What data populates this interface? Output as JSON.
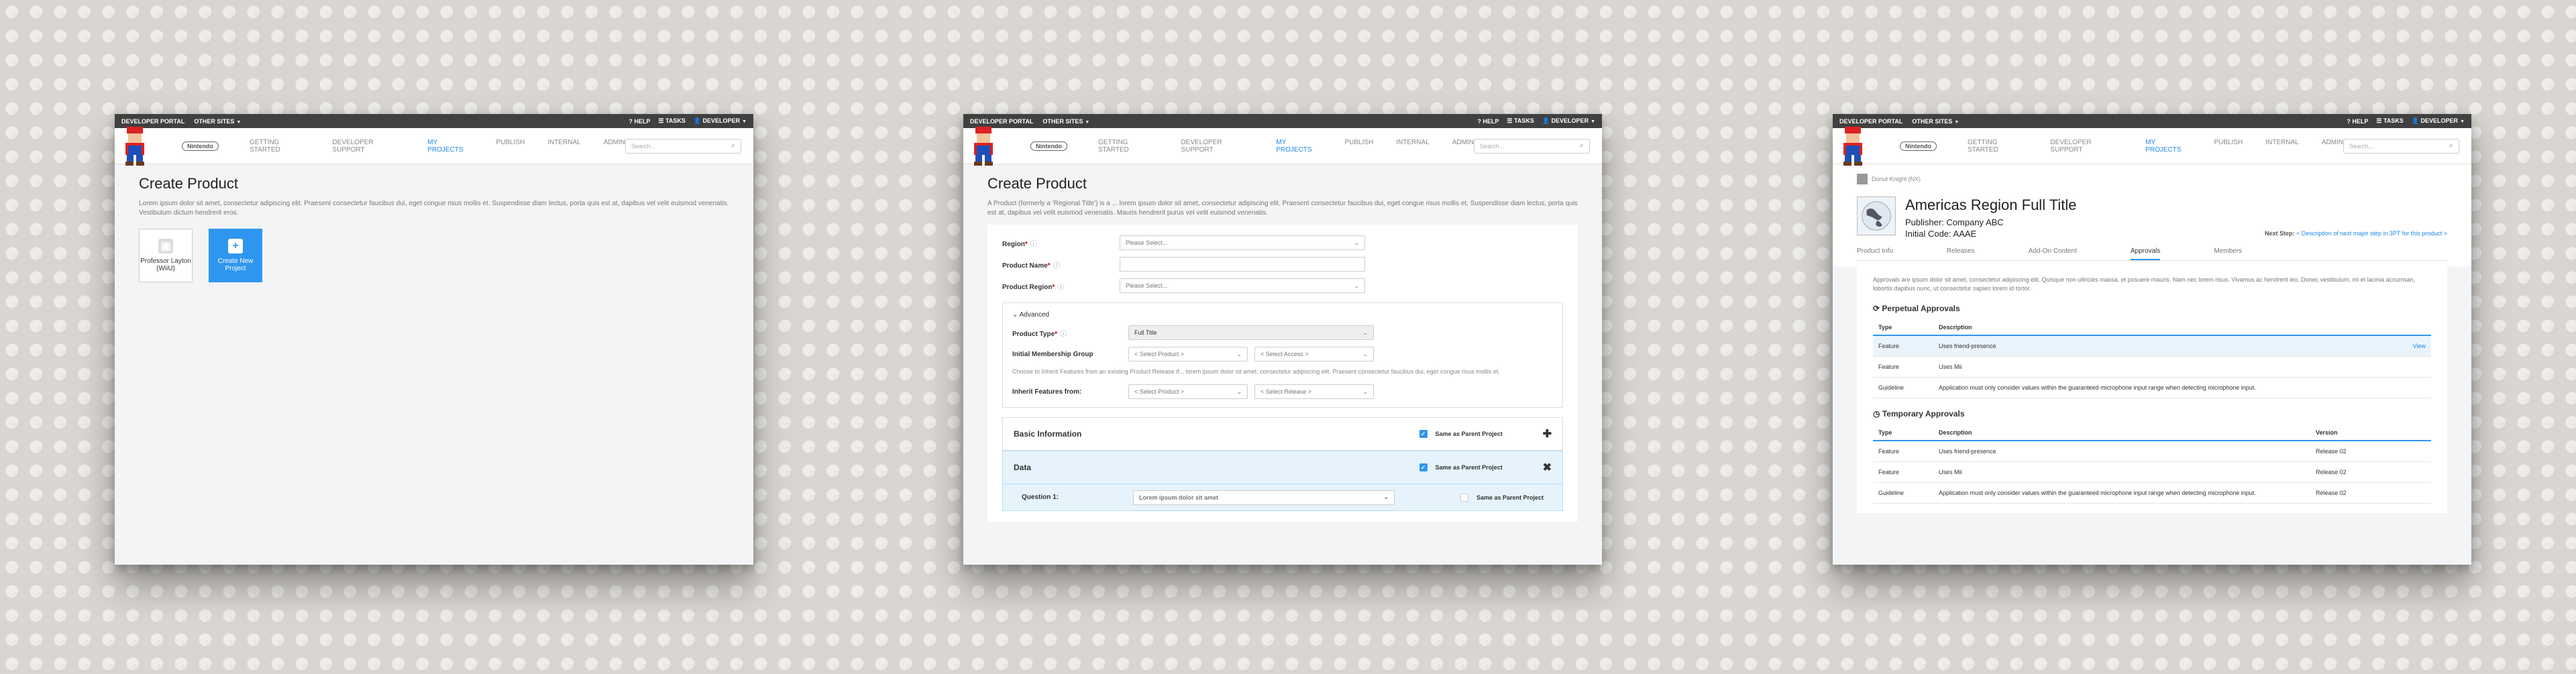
{
  "topbar": {
    "portal": "DEVELOPER PORTAL",
    "other": "OTHER SITES",
    "help": "HELP",
    "tasks": "TASKS",
    "user": "DEVELOPER"
  },
  "nav": {
    "logo": "Nintendo",
    "items": [
      "GETTING STARTED",
      "DEVELOPER SUPPORT",
      "MY PROJECTS",
      "PUBLISH",
      "INTERNAL",
      "ADMIN"
    ],
    "search_placeholder": "Search..."
  },
  "lorem_long": "Lorem ipsum dolor sit amet, consectetur adipiscing elit. Praesent consectetur faucibus dui, eget congue risus mollis et. Suspendisse diam lectus, porta quis est at, dapibus vel velit euismod venenatis. Vestibulum dictum hendrerit eros.",
  "screen1": {
    "title": "Create Product",
    "tile1": "Professor Layton (WiiU)",
    "tile2": "Create New Project"
  },
  "screen2": {
    "title": "Create Product",
    "intro": "A Product (formerly a 'Regional Title') is a ... lorem ipsum dolor sit amet, consectetur adipiscing elit. Praesent consectetur faucibus dui, eget congue risus mollis et. Suspendisse diam lectus, porta quis est at, dapibus vel velit euismod venenatis. Mauris hendrerit purus vel velit euismod venenatis.",
    "region_label": "Region",
    "product_name_label": "Product Name",
    "product_region_label": "Product Region",
    "please_select": "Please Select...",
    "advanced": "Advanced",
    "product_type_label": "Product Type",
    "product_type_value": "Full Title",
    "membership_label": "Initial Membership Group",
    "select_product": "< Select Product >",
    "select_access": "< Select Access >",
    "inherit_note": "Choose to Inherit Features from an existing Product Release if... lorem ipsum dolor sit amet, consectetur adipiscing elit. Praesent consectetur faucibus dui, eget congue risus mollis et.",
    "inherit_label": "Inherit Features from:",
    "select_release": "< Select Release >",
    "basic_info": "Basic Information",
    "same_as_parent": "Same as Parent Project",
    "data": "Data",
    "question": "Question 1:",
    "question_value": "Lorem ipsum dolor sit amet"
  },
  "screen3": {
    "crumb": "Donut Knight (NX)",
    "title": "Americas Region Full Title",
    "publisher": "Publisher: Company ABC",
    "initial_code": "Initial Code: AAAE",
    "next_step_label": "Next Step:",
    "next_step": "< Description of next major step in 3PT for this product >",
    "tabs": [
      "Product Info",
      "Releases",
      "Add-On Content",
      "Approvals",
      "Members"
    ],
    "intro": "Approvals are ipsum dolor sit amet, consectetur adipiscing elit. Quisque non ultricies massa, et posuere mauris. Nam nec lorem risus. Vivamus ac hendrerit leo. Donec vestibulum, mi et lacinia accumsan, lobortis dapibus nunc, ut consectetur sapien lorem id tortor.",
    "perpetual": "Perpetual Approvals",
    "temporary": "Temporary Approvals",
    "col_type": "Type",
    "col_desc": "Description",
    "col_version": "Version",
    "view": "View",
    "perpetual_rows": [
      [
        "Feature",
        "Uses friend-presence"
      ],
      [
        "Feature",
        "Uses Mii"
      ],
      [
        "Guideline",
        "Application must only consider values within the guaranteed microphone input range when detecting microphone input."
      ]
    ],
    "temporary_rows": [
      [
        "Feature",
        "Uses friend-presence",
        "Release 02"
      ],
      [
        "Feature",
        "Uses Mii",
        "Release 02"
      ],
      [
        "Guideline",
        "Application must only consider values within the guaranteed microphone input range when detecting microphone input.",
        "Release 02"
      ]
    ]
  }
}
